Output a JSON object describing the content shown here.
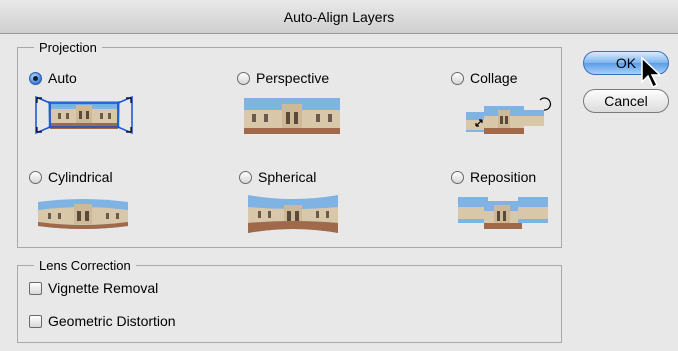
{
  "window": {
    "title": "Auto-Align Layers"
  },
  "projection": {
    "legend": "Projection",
    "options": [
      {
        "label": "Auto",
        "selected": true
      },
      {
        "label": "Perspective",
        "selected": false
      },
      {
        "label": "Collage",
        "selected": false
      },
      {
        "label": "Cylindrical",
        "selected": false
      },
      {
        "label": "Spherical",
        "selected": false
      },
      {
        "label": "Reposition",
        "selected": false
      }
    ]
  },
  "lens_correction": {
    "legend": "Lens Correction",
    "options": [
      {
        "label": "Vignette Removal",
        "checked": false
      },
      {
        "label": "Geometric Distortion",
        "checked": false
      }
    ]
  },
  "buttons": {
    "ok": "OK",
    "cancel": "Cancel"
  },
  "colors": {
    "accent": "#3a7bd5",
    "selection_box": "#1a4fd0"
  }
}
